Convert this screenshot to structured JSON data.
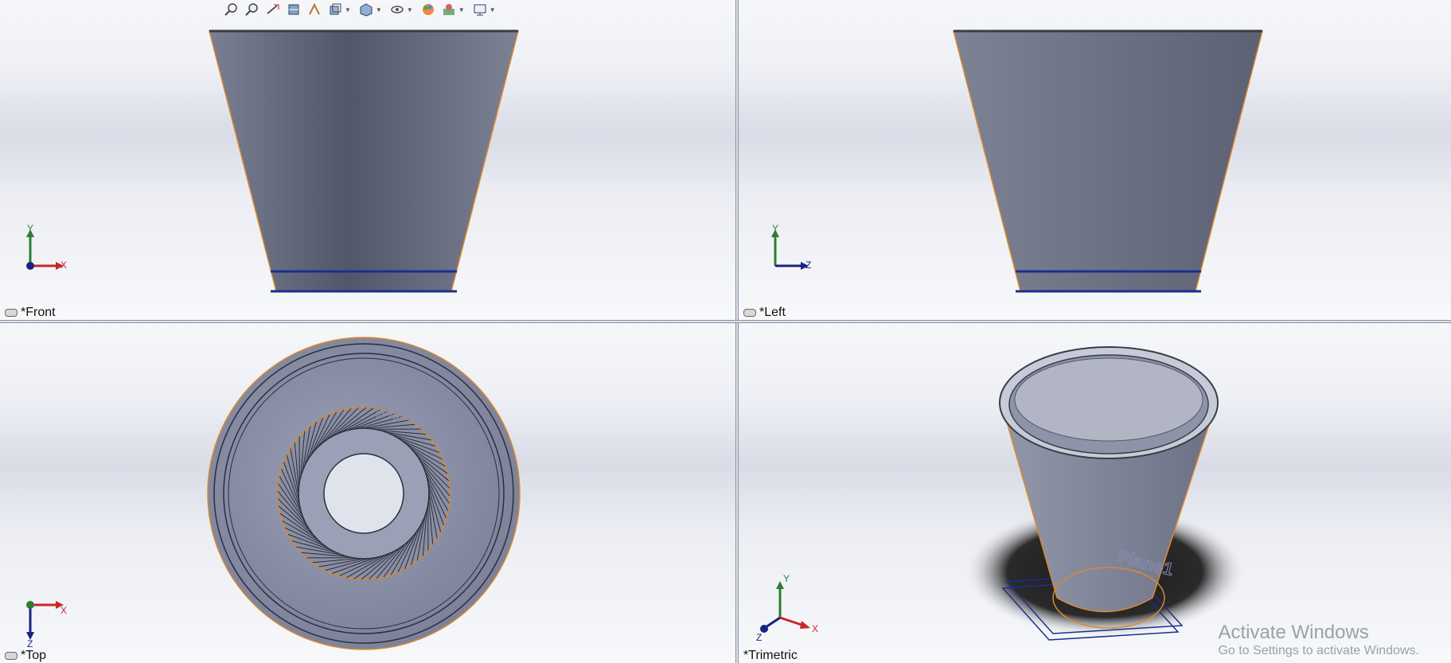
{
  "viewports": {
    "front": {
      "label": "*Front",
      "axis_h": "X",
      "axis_v": "Y"
    },
    "left": {
      "label": "*Left",
      "axis_h": "Z",
      "axis_v": "Y"
    },
    "top": {
      "label": "*Top",
      "axis_h": "X",
      "axis_v": "Z"
    },
    "trimetric": {
      "label": "*Trimetric",
      "axis_x": "X",
      "axis_y": "Y",
      "axis_z": "Z"
    }
  },
  "annotations": {
    "plane_label": "Plane1"
  },
  "toolbar": {
    "icons": [
      "zoom-to-fit-icon",
      "zoom-to-area-icon",
      "previous-view-icon",
      "section-view-icon",
      "dynamic-annotation-icon",
      "view-orientation-icon",
      "display-style-icon",
      "hide-show-icon",
      "edit-appearance-icon",
      "apply-scene-icon",
      "view-settings-icon"
    ]
  },
  "watermark": {
    "line1": "Activate Windows",
    "line2": "Go to Settings to activate Windows."
  },
  "colors": {
    "part_fill": "#6e7282",
    "edge_highlight": "#d98a2b",
    "sketch_line": "#1b2f8f",
    "axis_x": "#c62828",
    "axis_y": "#2e7d32",
    "axis_z": "#1a237e"
  }
}
